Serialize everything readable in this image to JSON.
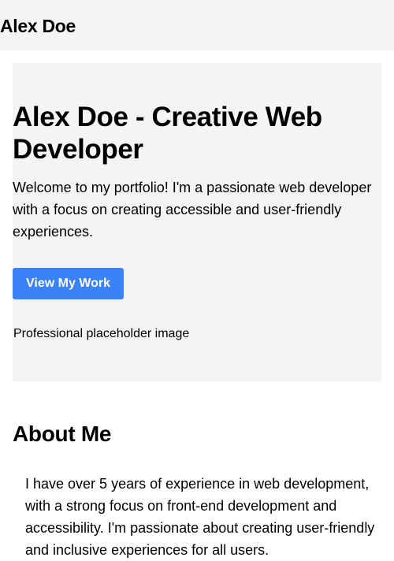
{
  "header": {
    "site_title": "Alex Doe"
  },
  "hero": {
    "title": "Alex Doe - Creative Web Developer",
    "intro": "Welcome to my portfolio! I'm a passionate web developer with a focus on creating accessible and user-friendly experiences.",
    "cta_label": "View My Work",
    "image_alt": "Professional placeholder image",
    "image_icon": "broken-image-icon"
  },
  "about": {
    "title": "About Me",
    "text": "I have over 5 years of experience in web development, with a strong focus on front-end development and accessibility. I'm passionate about creating user-friendly and inclusive experiences for all users."
  },
  "colors": {
    "header_bg": "#f3f4f6",
    "hero_bg": "#f3f4f6",
    "button_bg": "#3b82f6",
    "button_text": "#ffffff"
  }
}
